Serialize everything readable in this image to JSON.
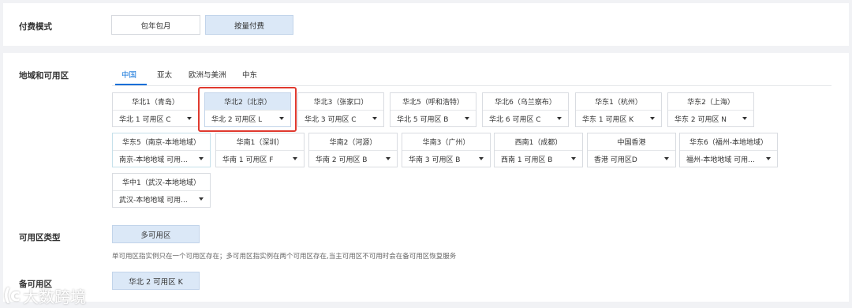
{
  "billing": {
    "label": "付费模式",
    "options": [
      "包年包月",
      "按量付费"
    ],
    "selected_index": 1
  },
  "region": {
    "label": "地域和可用区",
    "tabs": [
      "中国",
      "亚太",
      "欧洲与美洲",
      "中东"
    ],
    "active_tab": 0,
    "zones": [
      {
        "name": "华北1（青岛）",
        "zone": "华北 1 可用区 C"
      },
      {
        "name": "华北2（北京）",
        "zone": "华北 2 可用区 L"
      },
      {
        "name": "华北3（张家口）",
        "zone": "华北 3 可用区 C"
      },
      {
        "name": "华北5（呼和浩特）",
        "zone": "华北 5 可用区 B"
      },
      {
        "name": "华北6（乌兰察布）",
        "zone": "华北 6 可用区 C"
      },
      {
        "name": "华东1（杭州）",
        "zone": "华东 1 可用区 K"
      },
      {
        "name": "华东2（上海）",
        "zone": "华东 2 可用区 N"
      },
      {
        "name": "华东5（南京-本地地域）",
        "zone": "南京-本地地域 可用..."
      },
      {
        "name": "华南1（深圳）",
        "zone": "华南 1 可用区 F"
      },
      {
        "name": "华南2（河源）",
        "zone": "华南 2 可用区 B"
      },
      {
        "name": "华南3（广州）",
        "zone": "华南 3 可用区 B"
      },
      {
        "name": "西南1（成都）",
        "zone": "西南 1 可用区 B"
      },
      {
        "name": "中国香港",
        "zone": "香港 可用区D"
      },
      {
        "name": "华东6（福州-本地地域）",
        "zone": "福州-本地地域 可用..."
      },
      {
        "name": "华中1（武汉-本地地域）",
        "zone": "武汉-本地地域 可用..."
      }
    ],
    "selected_zone_index": 1
  },
  "az_type": {
    "label": "可用区类型",
    "option": "多可用区",
    "hint": "单可用区指实例只在一个可用区存在；多可用区指实例在两个可用区存在,当主可用区不可用时会在备可用区恢复服务"
  },
  "backup_zone": {
    "label": "备可用区",
    "value": "华北 2 可用区 K"
  },
  "watermark": {
    "text": "大数跨境",
    "logo": "(c"
  },
  "colors": {
    "accent": "#0a6fd8",
    "selected_bg": "#dbe8f7",
    "highlight_border": "#e03a2f"
  }
}
